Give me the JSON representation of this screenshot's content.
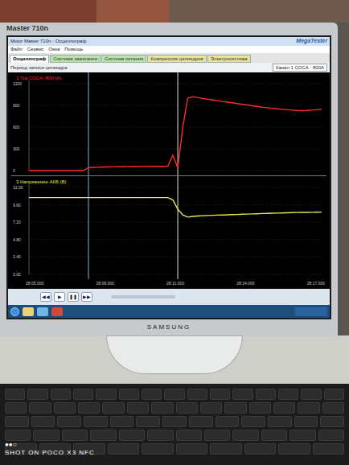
{
  "monitor": {
    "brand": "Master 710n",
    "maker": "SAMSUNG"
  },
  "app": {
    "title": "Motor Master 710n - Осциллограф",
    "logo": "MegaTester",
    "menu": [
      "Файл",
      "Сервис",
      "Окна",
      "Помощь"
    ],
    "tabs": [
      {
        "label": "Осциллограф",
        "selected": true,
        "color": "#ffffff"
      },
      {
        "label": "Система зажигания",
        "selected": false,
        "color": "#b9e3a8"
      },
      {
        "label": "Система питания",
        "selected": false,
        "color": "#b9e3a8"
      },
      {
        "label": "Компрессия цилиндров",
        "selected": false,
        "color": "#e9e39a"
      },
      {
        "label": "Электросистема",
        "selected": false,
        "color": "#e9e39a"
      }
    ],
    "channel_select": "Канал 1 СОСА - 800А",
    "period_label": "Период записи цилиндра"
  },
  "charts": [
    {
      "title": "1 Ток СОСА -800 (A)",
      "color": "#ff2b2b",
      "ticks": [
        "1200",
        "900",
        "600",
        "300",
        "0"
      ],
      "values": [
        0,
        0,
        0,
        0,
        0,
        0,
        0,
        0,
        0,
        0,
        0,
        0,
        40,
        44,
        46,
        48,
        50,
        51,
        52,
        53,
        54,
        55,
        56,
        57,
        57,
        58,
        58,
        59,
        60,
        210,
        40,
        600,
        1000,
        1020,
        1010,
        995,
        985,
        975,
        965,
        955,
        945,
        935,
        925,
        915,
        905,
        895,
        885,
        875,
        868,
        860,
        852,
        846,
        840,
        835,
        830,
        828,
        830,
        835,
        840,
        845
      ]
    },
    {
      "title": "3 Напряжение АКБ (В)",
      "color": "#e6e64a",
      "ticks": [
        "12.00",
        "9.60",
        "7.20",
        "4.80",
        "2.40",
        "0.00"
      ],
      "values": [
        10.6,
        10.6,
        10.6,
        10.6,
        10.6,
        10.6,
        10.6,
        10.6,
        10.6,
        10.6,
        10.6,
        10.6,
        10.6,
        10.6,
        10.6,
        10.6,
        10.6,
        10.6,
        10.6,
        10.6,
        10.6,
        10.6,
        10.6,
        10.6,
        10.6,
        10.6,
        10.6,
        10.6,
        10.6,
        10.3,
        9.0,
        8.2,
        7.9,
        8.0,
        8.05,
        8.1,
        8.12,
        8.15,
        8.18,
        8.2,
        8.22,
        8.25,
        8.27,
        8.3,
        8.32,
        8.35,
        8.37,
        8.4,
        8.42,
        8.44,
        8.46,
        8.48,
        8.5,
        8.52,
        8.54,
        8.55,
        8.56,
        8.57,
        8.58,
        8.6
      ]
    }
  ],
  "cursors": [
    {
      "index": 12,
      "color": "#8fc3f0"
    },
    {
      "index": 30,
      "color": "#ffffff"
    }
  ],
  "time_ticks": [
    "28:05.000",
    "28:08.000",
    "28:11.000",
    "28:14.000",
    "28:17.000"
  ],
  "controls": [
    "◀◀",
    "▶",
    "❚❚",
    "▶▶"
  ],
  "watermark": {
    "dots": "●●○",
    "text": "SHOT ON POCO X3 NFC"
  }
}
